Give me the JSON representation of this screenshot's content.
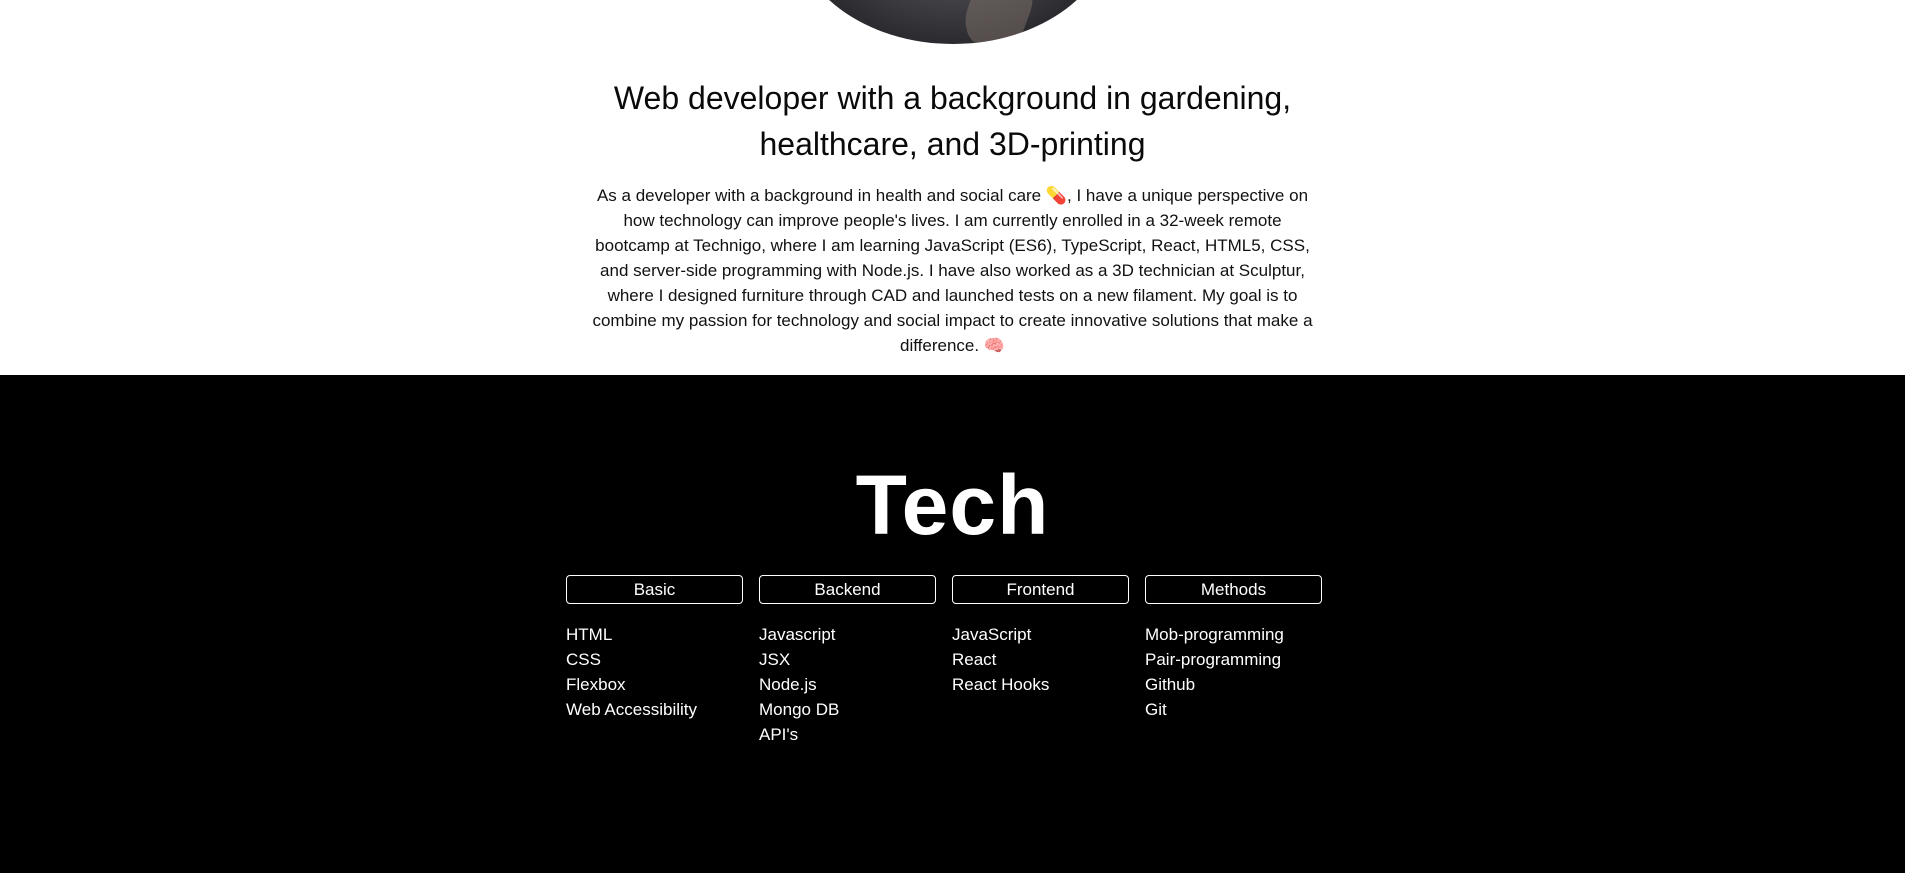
{
  "intro": {
    "headline": "Web developer with a background in gardening, healthcare, and 3D-printing",
    "bio": "As a developer with a background in health and social care 💊, I have a unique perspective on how technology can improve people's lives. I am currently enrolled in a 32-week remote bootcamp at Technigo, where I am learning JavaScript (ES6), TypeScript, React, HTML5, CSS, and server-side programming with Node.js. I have also worked as a 3D technician at Sculptur, where I designed furniture through CAD and launched tests on a new filament. My goal is to combine my passion for technology and social impact to create innovative solutions that make a difference. 🧠"
  },
  "tech": {
    "title": "Tech",
    "columns": [
      {
        "header": "Basic",
        "items": [
          "HTML",
          "CSS",
          "Flexbox",
          "Web Accessibility"
        ]
      },
      {
        "header": "Backend",
        "items": [
          "Javascript",
          "JSX",
          "Node.js",
          "Mongo DB",
          "API's"
        ]
      },
      {
        "header": "Frontend",
        "items": [
          "JavaScript",
          "React",
          "React Hooks"
        ]
      },
      {
        "header": "Methods",
        "items": [
          "Mob-programming",
          "Pair-programming",
          "Github",
          "Git"
        ]
      }
    ]
  },
  "colors": {
    "section_bg": "#000000",
    "page_bg": "#ffffff",
    "text_light": "#ffffff"
  }
}
